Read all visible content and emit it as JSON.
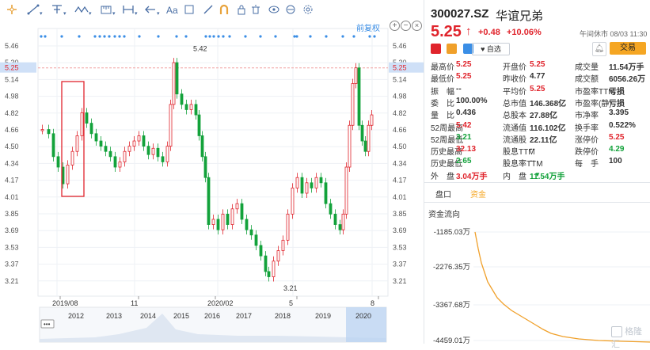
{
  "toolbar": {
    "icons": [
      "crosshair-icon",
      "trend-line-icon",
      "pitchfork-icon",
      "wave-icon",
      "measure-icon",
      "range-icon",
      "arrow-icon",
      "text-icon",
      "rect-icon",
      "brush-icon",
      "magnet-icon",
      "lock-icon",
      "trash-icon",
      "eye-icon",
      "sync-icon",
      "settings-icon"
    ],
    "text_tool": "Aa"
  },
  "chart": {
    "adjust_label": "前复权",
    "price_ticks": [
      "5.46",
      "5.30",
      "5.14",
      "4.98",
      "4.82",
      "4.66",
      "4.50",
      "4.34",
      "4.17",
      "4.01",
      "3.85",
      "3.69",
      "3.53",
      "3.37",
      "3.21"
    ],
    "current_price_tag": "5.25",
    "high_label": "5.42",
    "low_label": "3.21",
    "x_labels": [
      "2019/08",
      "11",
      "2020/02",
      "5",
      "8"
    ],
    "overview_years": [
      "2012",
      "2013",
      "2014",
      "2015",
      "2016",
      "2017",
      "2018",
      "2019",
      "2020"
    ],
    "colors": {
      "up": "#e0242c",
      "down": "#13a23b",
      "accent": "#3a8ee6",
      "grid": "#eef1f5"
    }
  },
  "quote": {
    "code": "300027.SZ",
    "name": "华谊兄弟",
    "price": "5.25",
    "arrow": "↑",
    "change": "+0.48",
    "change_pct": "+10.06%",
    "status": "午间休市 08/03 11:30",
    "trade_button": "交易",
    "watch_button": "自选",
    "stats": [
      {
        "label": "最高价",
        "value": "5.25",
        "color": "r"
      },
      {
        "label": "开盘价",
        "value": "5.25",
        "color": "r"
      },
      {
        "label": "成交量",
        "value": "11.54万手",
        "color": "n"
      },
      {
        "label": "最低价",
        "value": "5.25",
        "color": "r"
      },
      {
        "label": "昨收价",
        "value": "4.77",
        "color": "n"
      },
      {
        "label": "成交额",
        "value": "6056.26万",
        "color": "n"
      },
      {
        "label": "振　幅",
        "value": "--",
        "color": "n"
      },
      {
        "label": "平均价",
        "value": "5.25",
        "color": "r"
      },
      {
        "label": "市盈率TTM",
        "value": "亏损",
        "color": "n"
      },
      {
        "label": "委　比",
        "value": "100.00%",
        "color": "n"
      },
      {
        "label": "总市值",
        "value": "146.368亿",
        "color": "n"
      },
      {
        "label": "市盈率(静)",
        "value": "亏损",
        "color": "n"
      },
      {
        "label": "量　比",
        "value": "0.436",
        "color": "n"
      },
      {
        "label": "总股本",
        "value": "27.88亿",
        "color": "n"
      },
      {
        "label": "市净率",
        "value": "3.395",
        "color": "n"
      },
      {
        "label": "52周最高",
        "value": "5.42",
        "color": "r"
      },
      {
        "label": "流通值",
        "value": "116.102亿",
        "color": "n"
      },
      {
        "label": "换手率",
        "value": "0.522%",
        "color": "n"
      },
      {
        "label": "52周最低",
        "value": "3.21",
        "color": "g"
      },
      {
        "label": "流通股",
        "value": "22.11亿",
        "color": "n"
      },
      {
        "label": "涨停价",
        "value": "5.25",
        "color": "r"
      },
      {
        "label": "历史最高",
        "value": "32.13",
        "color": "r"
      },
      {
        "label": "股息TTM",
        "value": "--",
        "color": "n"
      },
      {
        "label": "跌停价",
        "value": "4.29",
        "color": "g"
      },
      {
        "label": "历史最低",
        "value": "2.65",
        "color": "g"
      },
      {
        "label": "股息率TTM",
        "value": "--",
        "color": "n"
      },
      {
        "label": "每　手",
        "value": "100",
        "color": "n"
      },
      {
        "label": "外　盘",
        "value": "3.04万手",
        "color": "r"
      },
      {
        "label": "内　盘",
        "value": "11.54万手",
        "color": "g"
      }
    ],
    "tabs": [
      "盘口",
      "资金"
    ],
    "fund_flow": {
      "title": "资金流向",
      "ticks": [
        "-1185.03万",
        "-2276.35万",
        "-3367.68万",
        "-4459.01万"
      ]
    },
    "watermark": "格隆汇"
  }
}
